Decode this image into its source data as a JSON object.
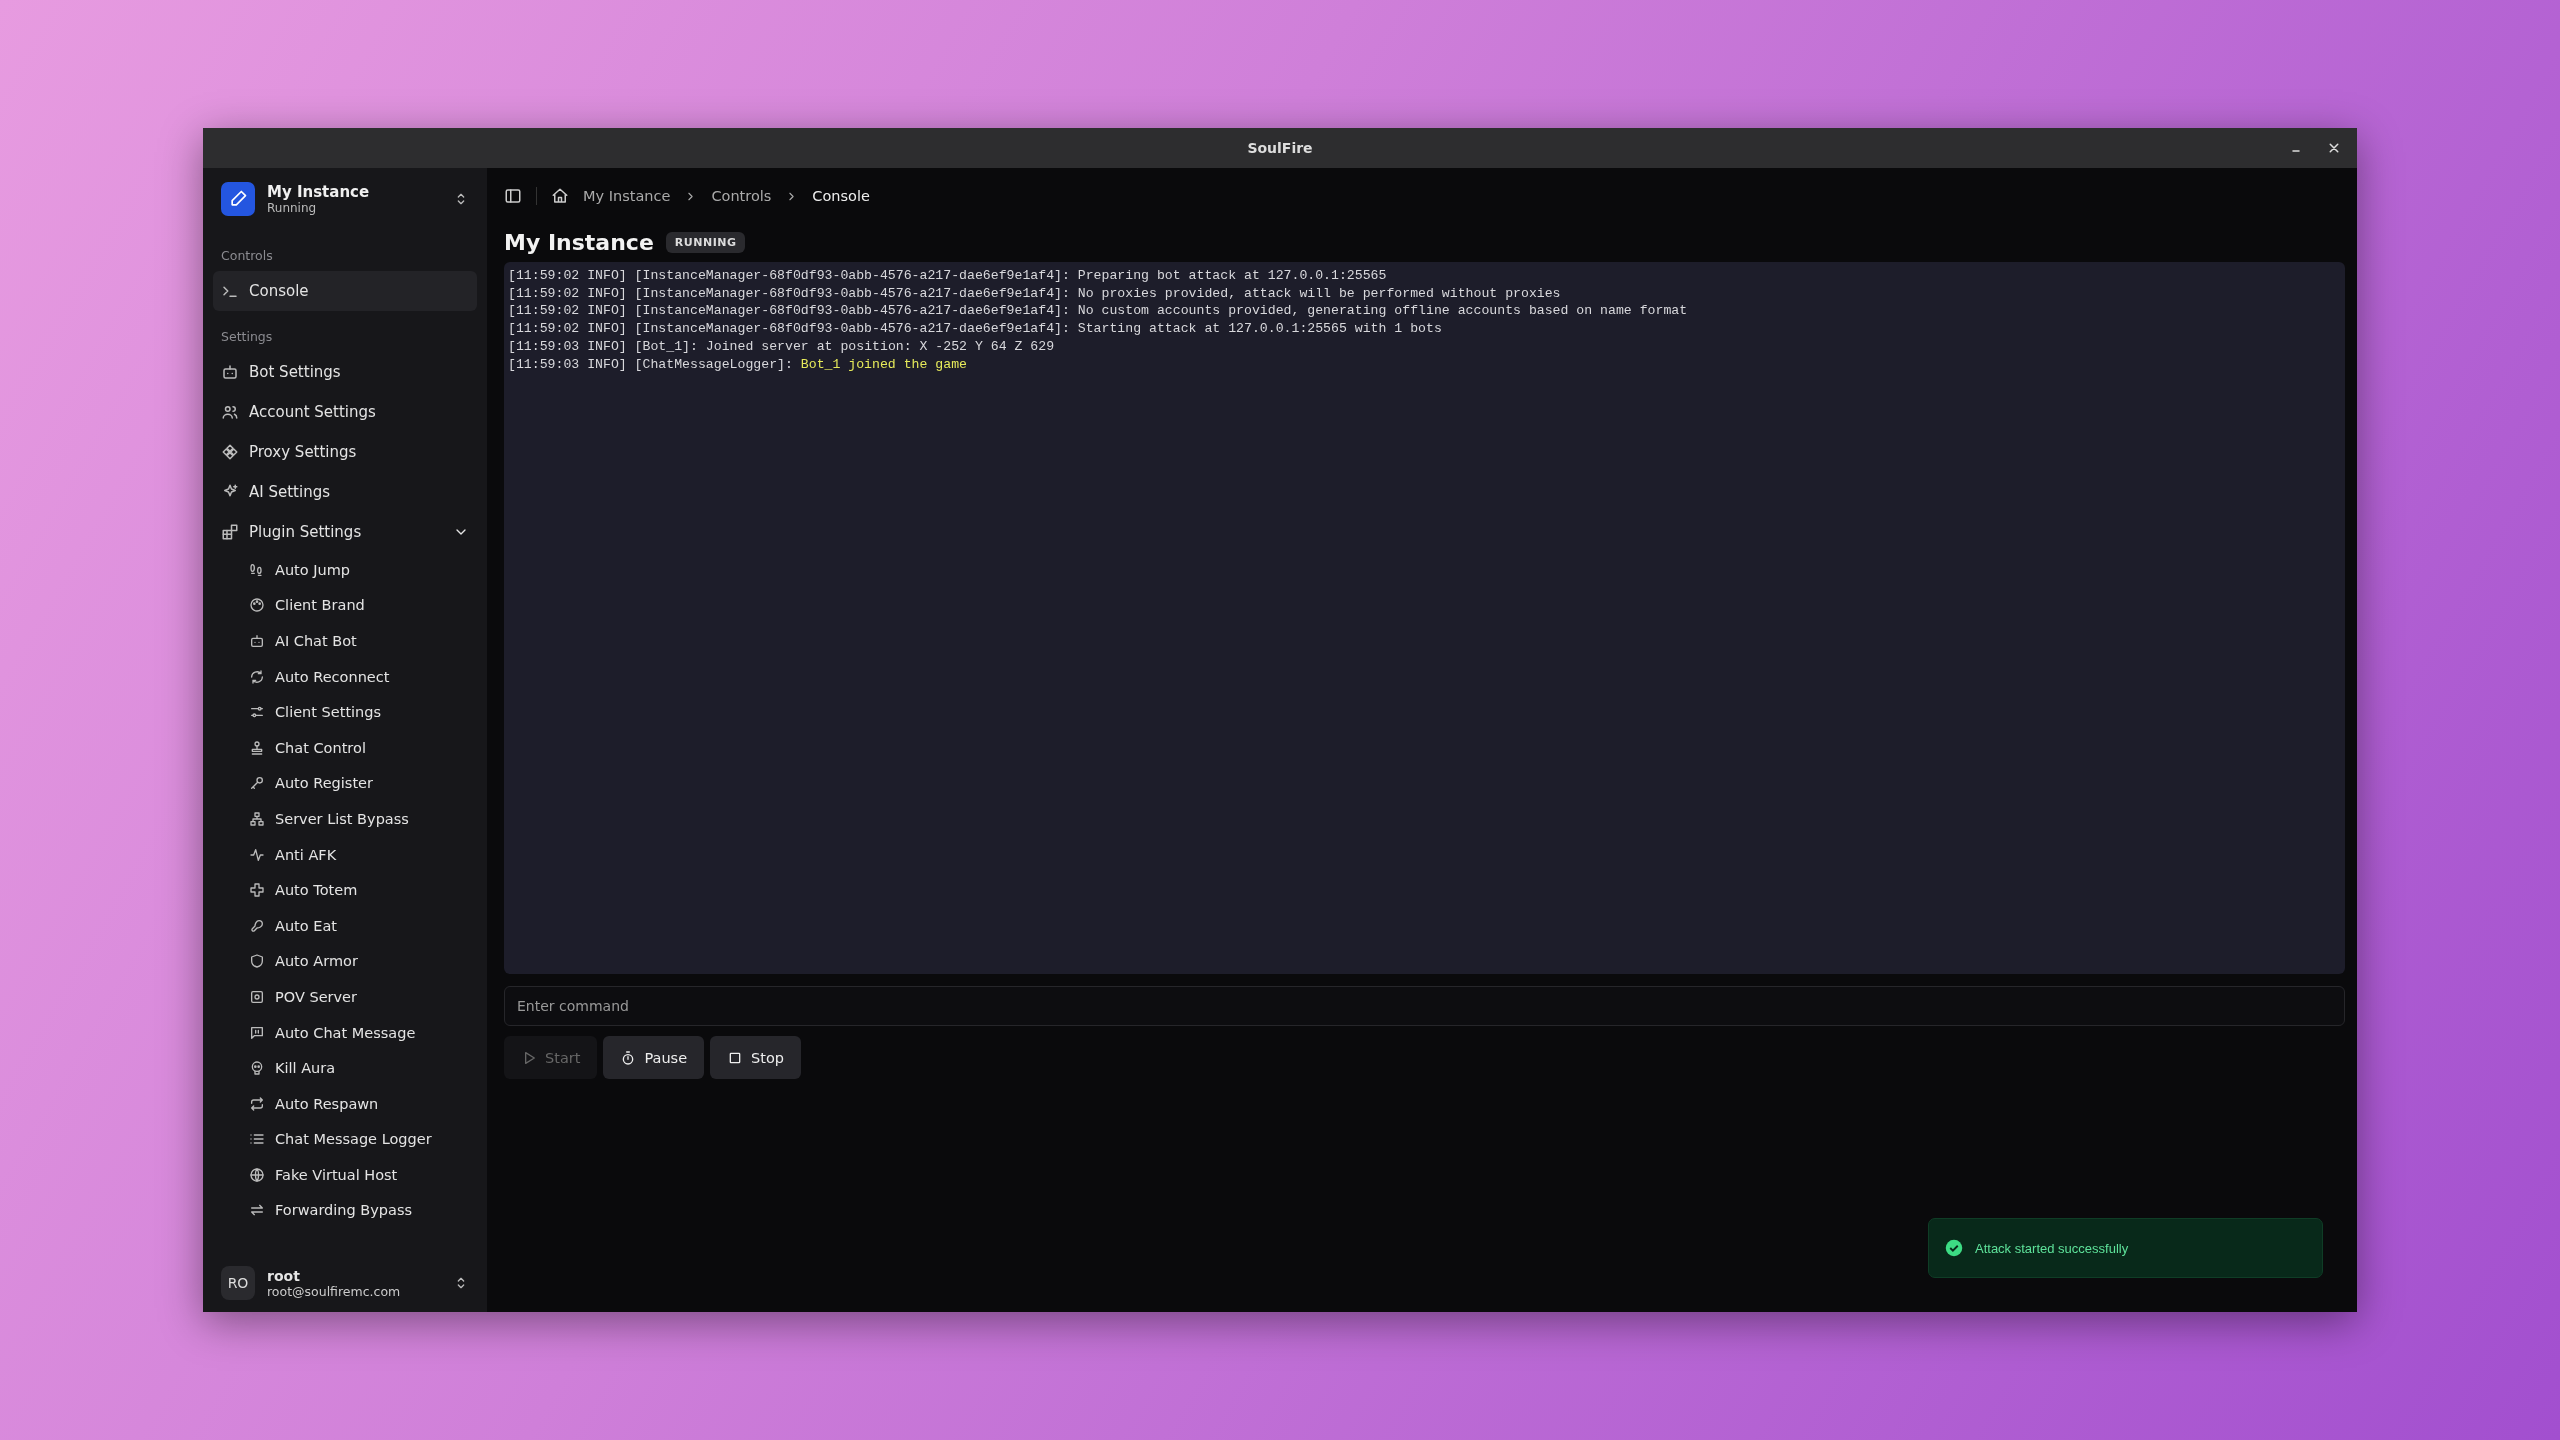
{
  "window": {
    "title": "SoulFire"
  },
  "sidebar": {
    "instance": {
      "name": "My Instance",
      "status": "Running"
    },
    "groups": [
      {
        "label": "Controls",
        "items": [
          {
            "label": "Console",
            "selected": true
          }
        ]
      },
      {
        "label": "Settings",
        "items": [
          {
            "label": "Bot Settings",
            "selected": false
          },
          {
            "label": "Account Settings",
            "selected": false
          },
          {
            "label": "Proxy Settings",
            "selected": false
          },
          {
            "label": "AI Settings",
            "selected": false
          },
          {
            "label": "Plugin Settings",
            "selected": false,
            "expanded": true,
            "children": [
              {
                "label": "Auto Jump",
                "selected": false
              },
              {
                "label": "Client Brand",
                "selected": false
              },
              {
                "label": "AI Chat Bot",
                "selected": false
              },
              {
                "label": "Auto Reconnect",
                "selected": false
              },
              {
                "label": "Client Settings",
                "selected": false
              },
              {
                "label": "Chat Control",
                "selected": false
              },
              {
                "label": "Auto Register",
                "selected": false
              },
              {
                "label": "Server List Bypass",
                "selected": false
              },
              {
                "label": "Anti AFK",
                "selected": false
              },
              {
                "label": "Auto Totem",
                "selected": false
              },
              {
                "label": "Auto Eat",
                "selected": false
              },
              {
                "label": "Auto Armor",
                "selected": false
              },
              {
                "label": "POV Server",
                "selected": false
              },
              {
                "label": "Auto Chat Message",
                "selected": false
              },
              {
                "label": "Kill Aura",
                "selected": false
              },
              {
                "label": "Auto Respawn",
                "selected": false
              },
              {
                "label": "Chat Message Logger",
                "selected": false
              },
              {
                "label": "Fake Virtual Host",
                "selected": false
              },
              {
                "label": "Forwarding Bypass",
                "selected": false
              }
            ]
          }
        ]
      }
    ],
    "user": {
      "initials": "RO",
      "name": "root",
      "email": "root@soulfiremc.com"
    }
  },
  "breadcrumb": [
    "My Instance",
    "Controls",
    "Console"
  ],
  "page": {
    "title": "My Instance",
    "status": "RUNNING"
  },
  "console": {
    "lines": [
      {
        "prefix": "[11:59:02 INFO] [InstanceManager-68f0df93-0abb-4576-a217-dae6ef9e1af4]: ",
        "message": "Preparing bot attack at 127.0.0.1:25565",
        "highlight": false
      },
      {
        "prefix": "[11:59:02 INFO] [InstanceManager-68f0df93-0abb-4576-a217-dae6ef9e1af4]: ",
        "message": "No proxies provided, attack will be performed without proxies",
        "highlight": false
      },
      {
        "prefix": "[11:59:02 INFO] [InstanceManager-68f0df93-0abb-4576-a217-dae6ef9e1af4]: ",
        "message": "No custom accounts provided, generating offline accounts based on name format",
        "highlight": false
      },
      {
        "prefix": "[11:59:02 INFO] [InstanceManager-68f0df93-0abb-4576-a217-dae6ef9e1af4]: ",
        "message": "Starting attack at 127.0.0.1:25565 with 1 bots",
        "highlight": false
      },
      {
        "prefix": "[11:59:03 INFO] [Bot_1]: ",
        "message": "Joined server at position: X -252 Y 64 Z 629",
        "highlight": false
      },
      {
        "prefix": "[11:59:03 INFO] [ChatMessageLogger]: ",
        "message": "Bot_1 joined the game",
        "highlight": true
      }
    ],
    "command": {
      "placeholder": "Enter command"
    },
    "buttons": [
      {
        "kind": "start",
        "label": "Start",
        "disabled": true
      },
      {
        "kind": "pause",
        "label": "Pause",
        "disabled": false
      },
      {
        "kind": "stop",
        "label": "Stop",
        "disabled": false
      }
    ]
  },
  "toast": {
    "message": "Attack started successfully"
  }
}
